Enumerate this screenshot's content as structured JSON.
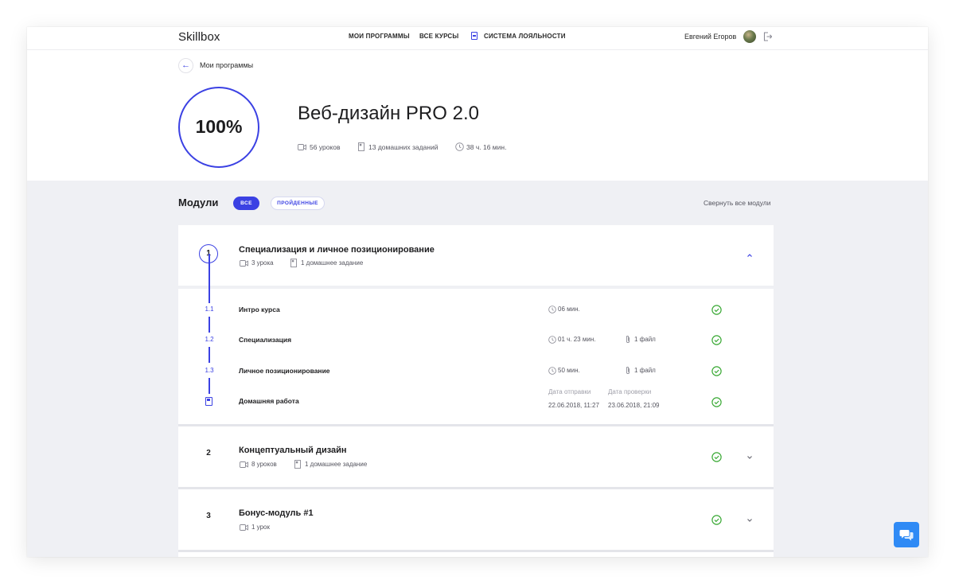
{
  "nav": {
    "logo": "Skillbox",
    "links": [
      "МОИ ПРОГРАММЫ",
      "ВСЕ КУРСЫ",
      "СИСТЕМА ЛОЯЛЬНОСТИ"
    ],
    "user_name": "Евгений Егоров"
  },
  "header": {
    "back_label": "Мои программы",
    "progress": "100%",
    "progress_value": 100,
    "course_title": "Веб-дизайн PRO 2.0",
    "lessons": "56 уроков",
    "homeworks": "13 домашних заданий",
    "duration": "38 ч. 16 мин."
  },
  "modules": {
    "title": "Модули",
    "filter_all": "ВСЕ",
    "filter_done": "ПРОЙДЕННЫЕ",
    "collapse_all": "Свернуть все модули",
    "items": [
      {
        "num": "1",
        "title": "Специализация и личное позиционирование",
        "lessons": "3 урока",
        "homeworks": "1 домашнее задание",
        "lessons_list": [
          {
            "num": "1.1",
            "title": "Интро курса",
            "duration": "06 мин.",
            "files": ""
          },
          {
            "num": "1.2",
            "title": "Специализация",
            "duration": "01 ч. 23 мин.",
            "files": "1 файл"
          },
          {
            "num": "1.3",
            "title": "Личное позиционирование",
            "duration": "50 мин.",
            "files": "1 файл"
          }
        ],
        "homework": {
          "title": "Домашняя работа",
          "sent_label": "Дата отправки",
          "sent_value": "22.06.2018, 11:27",
          "checked_label": "Дата проверки",
          "checked_value": "23.06.2018, 21:09"
        }
      },
      {
        "num": "2",
        "title": "Концептуальный дизайн",
        "lessons": "8 уроков",
        "homeworks": "1 домашнее задание"
      },
      {
        "num": "3",
        "title": "Бонус-модуль #1",
        "lessons": "1 урок"
      }
    ]
  },
  "colors": {
    "accent": "#3b41e3",
    "check": "#3aa935",
    "page_bg": "#eff0f4",
    "chat_button": "#2f8af5"
  },
  "icons": {
    "video": "video-camera-icon",
    "homework": "bookmark-icon",
    "clock": "clock-icon",
    "file": "paperclip-icon",
    "done": "check-circle-icon",
    "chat": "chat-bubbles-icon"
  }
}
